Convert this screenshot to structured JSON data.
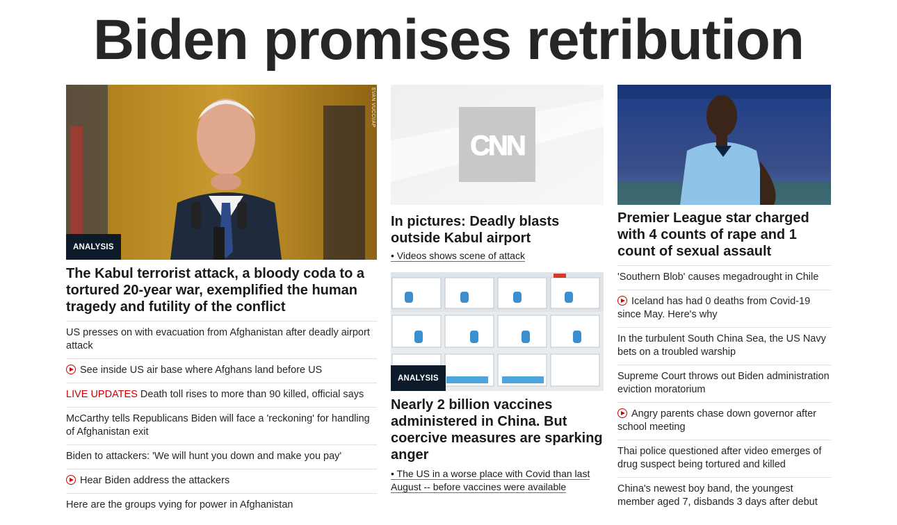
{
  "banner": {
    "headline": "Biden promises retribution"
  },
  "col1": {
    "image_credit": "EVAN VUCCI/AP",
    "badge": "ANALYSIS",
    "headline": "The Kabul terrorist attack, a bloody coda to a tortured 20-year war, exemplified the human tragedy and futility of the conflict",
    "links": [
      {
        "text": "US presses on with evacuation from Afghanistan after deadly airport attack"
      },
      {
        "video": true,
        "text": "See inside US air base where Afghans land before US"
      },
      {
        "live_label": "LIVE UPDATES",
        "text": "Death toll rises to more than 90 killed, official says"
      },
      {
        "text": "McCarthy tells Republicans Biden will face a 'reckoning' for handling of Afghanistan exit"
      },
      {
        "text": "Biden to attackers: 'We will hunt you down and make you pay'"
      },
      {
        "video": true,
        "text": "Hear Biden address the attackers"
      },
      {
        "text": "Here are the groups vying for power in Afghanistan"
      }
    ]
  },
  "col2": {
    "story1": {
      "logo": "CNN",
      "headline": "In pictures: Deadly blasts outside Kabul airport",
      "sub": "• Videos shows scene of attack"
    },
    "story2": {
      "badge": "ANALYSIS",
      "headline": "Nearly 2 billion vaccines administered in China. But coercive measures are sparking anger",
      "sub": "• The US in a worse place with Covid than last August -- before vaccines were available"
    }
  },
  "col3": {
    "headline": "Premier League star charged with 4 counts of rape and 1 count of sexual assault",
    "links": [
      {
        "text": "'Southern Blob' causes megadrought in Chile"
      },
      {
        "video": true,
        "text": "Iceland has had 0 deaths from Covid-19 since May. Here's why"
      },
      {
        "text": "In the turbulent South China Sea, the US Navy bets on a troubled warship"
      },
      {
        "text": "Supreme Court throws out Biden administration eviction moratorium"
      },
      {
        "video": true,
        "text": "Angry parents chase down governor after school meeting"
      },
      {
        "text": "Thai police questioned after video emerges of drug suspect being tortured and killed"
      },
      {
        "text": "China's newest boy band, the youngest member aged 7, disbands 3 days after debut"
      }
    ]
  },
  "colors": {
    "live_red": "#cc0000",
    "badge_navy": "#0c1a2a",
    "divider": "#e1e1e1"
  }
}
